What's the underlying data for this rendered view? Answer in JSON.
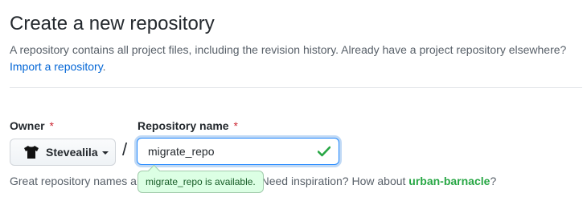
{
  "header": {
    "title": "Create a new repository",
    "description": "A repository contains all project files, including the revision history. Already have a project repository elsewhere?",
    "import_link": "Import a repository",
    "import_suffix": "."
  },
  "form": {
    "owner_label": "Owner",
    "repo_label": "Repository name",
    "required_mark": "*",
    "owner_value": "Stevealila",
    "separator": "/",
    "repo_value": "migrate_repo",
    "availability_message": "migrate_repo is available.",
    "hint_prefix": "Great repository names ar",
    "hint_middle": "Need inspiration? How about ",
    "hint_suggestion": "urban-barnacle",
    "hint_suffix": "?"
  },
  "colors": {
    "link": "#0366d6",
    "required": "#cb2431",
    "success": "#28a745",
    "focus_border": "#2188ff"
  },
  "icons": {
    "avatar": "tshirt-avatar-icon",
    "caret": "caret-down-icon",
    "check": "check-icon"
  }
}
